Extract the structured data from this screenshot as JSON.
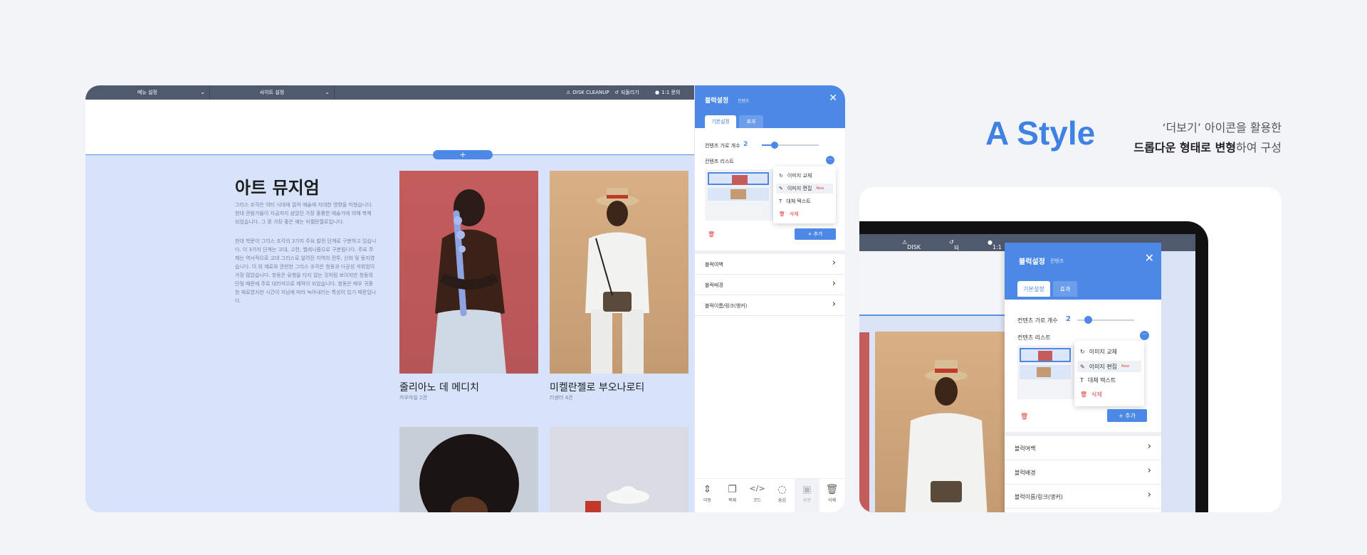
{
  "editor": {
    "topbar": {
      "menu_select": "메뉴 설정",
      "site_select": "사이트 설정",
      "disk_cleanup": "DISK CLEANUP",
      "undo": "되돌리기",
      "support": "1:1 문의"
    },
    "add_section": "+",
    "museum": {
      "title": "아트 뮤지엄",
      "para1": "그리스 조각은 여러 시대에 걸쳐 예술에 지대한 영향을 미쳤습니다. 현대 관람가들이 지금까지 삼았던 가장 훌륭한 예술가에 의해 복제 되었습니다. 그 중 가장 좋은 예는 미켈란젤로입니다.",
      "para2": "현대 학문이 그리스 조각의 3가지 주요 발전 단계로 구분하고 있습니다. 이 3가지 단계는 고대, 고전, 헬레니즘으로 구분됩니다. 주요 주제는 역사적으로 고대 그리스로 알려진 지역의 전투, 신화 및 동지였습니다. 이 외 재료와 관련한 그리스 조각은 청동과 다공성 석회암이 가장 많았습니다. 청동은 유행을 타지 않는 것처럼 보이지만 청동의 단점 때문에 주로 대리석으로 제작이 되었습니다. 청동은 매우 귀중한 재료였지만 시간이 지남에 따라 녹아내리는 특성이 있기 때문입니다."
    },
    "cards": [
      {
        "title": "줄리아노 데 메디치",
        "sub": "카우마일 2관"
      },
      {
        "title": "미켈란젤로 부오나로티",
        "sub": "리센터 4관"
      }
    ],
    "panel": {
      "title": "블럭설정",
      "subtitle": "컨텐츠",
      "tabs": [
        "기본설정",
        "효과"
      ],
      "columns_label": "컨텐츠 가로 개수",
      "columns_value": "2",
      "slider_fraction": 0.2,
      "list_label": "컨텐츠 리스트",
      "more": "···",
      "dropdown": [
        {
          "label": "이미지 교체",
          "icon": "↻"
        },
        {
          "label": "이미지 편집",
          "icon": "✎",
          "badge": "New"
        },
        {
          "label": "대체 텍스트",
          "icon": "T"
        },
        {
          "label": "삭제",
          "icon": "🗑"
        }
      ],
      "add_button": "+ 추가",
      "accordion": [
        "블럭여백",
        "블럭배경",
        "블럭이름/링크(앵커)"
      ],
      "tools": [
        {
          "label": "이동",
          "icon": "⇕"
        },
        {
          "label": "복제",
          "icon": "❐"
        },
        {
          "label": "코드",
          "icon": "</>"
        },
        {
          "label": "숨김",
          "icon": "◌"
        },
        {
          "label": "보관",
          "icon": "▣"
        },
        {
          "label": "삭제",
          "icon": "🗑"
        }
      ]
    }
  },
  "heading": {
    "title": "A Style",
    "line1": "‘더보기’ 아이콘을 활용한",
    "line2_bold": "드롭다운 형태로 변형",
    "line2_rest": "하여 구성"
  },
  "device": {
    "topbar": {
      "disk_cleanup": "DISK CLEANUP",
      "undo": "되돌리기",
      "support": "1:1 문의"
    },
    "panel": {
      "title": "블럭설정",
      "subtitle": "컨텐츠",
      "tabs": [
        "기본설정",
        "효과"
      ],
      "columns_label": "컨텐츠 가로 개수",
      "columns_value": "2",
      "list_label": "컨텐츠 리스트",
      "more": "···",
      "dropdown": [
        {
          "label": "이미지 교체",
          "icon": "↻"
        },
        {
          "label": "이미지 편집",
          "icon": "✎",
          "badge": "New"
        },
        {
          "label": "대체 텍스트",
          "icon": "T"
        },
        {
          "label": "삭제",
          "icon": "🗑"
        }
      ],
      "add_button": "+ 추가",
      "accordion": [
        "블럭여백",
        "블럭배경",
        "블럭이름/링크(앵커)"
      ]
    }
  },
  "colors": {
    "accent": "#4c89e6",
    "danger": "#e04545",
    "topbar": "#4f5a6e"
  }
}
